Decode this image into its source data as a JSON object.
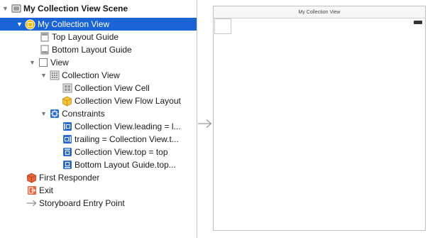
{
  "outline": {
    "items": [
      {
        "label": "My Collection View Scene"
      },
      {
        "label": "My Collection View"
      },
      {
        "label": "Top Layout Guide"
      },
      {
        "label": "Bottom Layout Guide"
      },
      {
        "label": "View"
      },
      {
        "label": "Collection View"
      },
      {
        "label": "Collection View Cell"
      },
      {
        "label": "Collection View Flow Layout"
      },
      {
        "label": "Constraints"
      },
      {
        "label": "Collection View.leading = l..."
      },
      {
        "label": "trailing = Collection View.t..."
      },
      {
        "label": "Collection View.top = top"
      },
      {
        "label": "Bottom Layout Guide.top..."
      },
      {
        "label": "First Responder"
      },
      {
        "label": "Exit"
      },
      {
        "label": "Storyboard Entry Point"
      }
    ]
  },
  "canvas": {
    "scene_title": "My Collection View"
  },
  "colors": {
    "selection": "#1b64d6",
    "vc_icon": "#f5b800",
    "constraint_icon": "#2b6bd1",
    "responder_icon": "#e8643a"
  }
}
